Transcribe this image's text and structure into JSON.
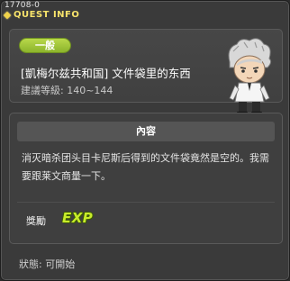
{
  "window": {
    "quest_id": "17708-0",
    "title": "QUEST INFO"
  },
  "info": {
    "category": "一般",
    "quest_name": "[凱梅尔兹共和国] 文件袋里的东西",
    "level": "建議等級: 140~144",
    "npc_icon": "npc-portrait-icon"
  },
  "content": {
    "header": "內容",
    "text": "消灭暗杀团头目卡尼斯后得到的文件袋竟然是空的。我需要跟莱文商量一下。",
    "reward_label": "獎勵",
    "reward_exp": "EXP"
  },
  "status": {
    "text": "狀態: 可開始"
  },
  "colors": {
    "title": "#f7e36b",
    "category_pill": "#a6c83c",
    "exp": "#c8ec2a"
  }
}
